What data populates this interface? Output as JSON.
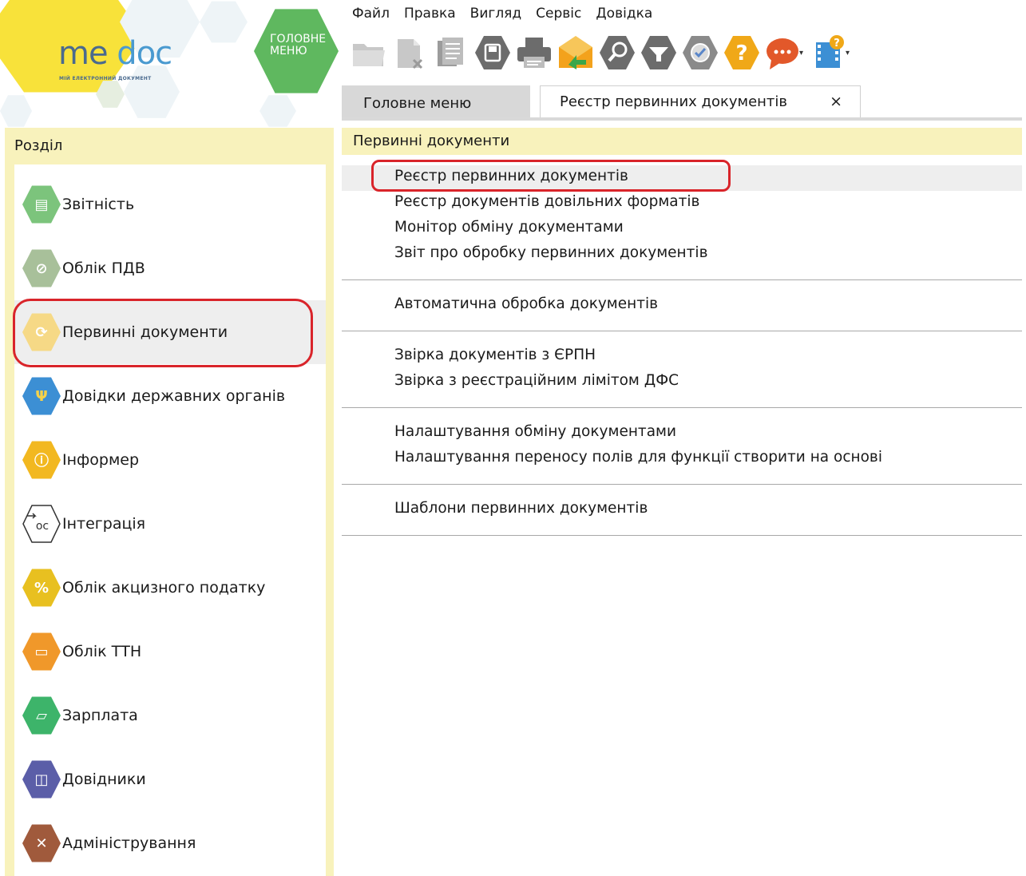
{
  "logo": {
    "me": "me",
    "doc": "doc",
    "subtitle": "МІЙ ЕЛЕКТРОННИЙ ДОКУМЕНТ"
  },
  "main_menu_button": {
    "line1": "ГОЛОВНЕ",
    "line2": "МЕНЮ"
  },
  "menubar": [
    "Файл",
    "Правка",
    "Вигляд",
    "Сервіс",
    "Довідка"
  ],
  "toolbar": {
    "icons": [
      "folder-icon",
      "document-delete-icon",
      "documents-icon",
      "save-icon",
      "printer-icon",
      "send-envelope-icon",
      "search-icon",
      "filter-icon",
      "verify-icon",
      "help-icon",
      "chat-icon",
      "video-help-icon"
    ]
  },
  "tabs": {
    "main": "Головне меню",
    "active": "Реєстр первинних документів",
    "close": "×"
  },
  "sidebar": {
    "title": "Розділ",
    "items": [
      {
        "label": "Звітність",
        "icon": "report-icon",
        "color": "#7cc47c"
      },
      {
        "label": "Облік ПДВ",
        "icon": "vat-icon",
        "color": "#a8c09a"
      },
      {
        "label": "Первинні документи",
        "icon": "refresh-documents-icon",
        "color": "#f6d986"
      },
      {
        "label": "Довідки державних органів",
        "icon": "trident-icon",
        "color": "#3c8fd4"
      },
      {
        "label": "Інформер",
        "icon": "info-icon",
        "color": "#f2b820"
      },
      {
        "label": "Інтеграція",
        "icon": "integration-icon",
        "color": "#ffffff"
      },
      {
        "label": "Облік акцизного податку",
        "icon": "excise-bag-icon",
        "color": "#e8c020"
      },
      {
        "label": "Облік ТТН",
        "icon": "ttn-icon",
        "color": "#f0982a"
      },
      {
        "label": "Зарплата",
        "icon": "salary-icon",
        "color": "#3db46a"
      },
      {
        "label": "Довідники",
        "icon": "book-icon",
        "color": "#5b5ea8"
      },
      {
        "label": "Адміністрування",
        "icon": "tools-icon",
        "color": "#a05a3c"
      }
    ]
  },
  "content": {
    "title": "Первинні документи",
    "groups": [
      [
        "Реєстр первинних документів",
        "Реєстр документів довільних форматів",
        "Монітор обміну документами",
        "Звіт про обробку первинних документів"
      ],
      [
        "Автоматична обробка документів"
      ],
      [
        "Звірка документів з ЄРПН",
        "Звірка з реєстраційним лімітом ДФС"
      ],
      [
        "Налаштування обміну документами",
        "Налаштування переносу полів для функції створити на основі"
      ],
      [
        "Шаблони первинних документів"
      ]
    ]
  },
  "colors": {
    "accent_yellow": "#f8f2bc",
    "highlight_red": "#d9242a",
    "tab_gray": "#d8d8d8"
  }
}
